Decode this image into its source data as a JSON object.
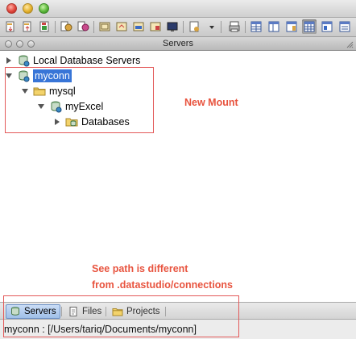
{
  "panel": {
    "title": "Servers"
  },
  "tree": {
    "items": [
      {
        "label": "Local Database Servers"
      },
      {
        "label": "myconn"
      },
      {
        "label": "mysql"
      },
      {
        "label": "myExcel"
      },
      {
        "label": "Databases"
      }
    ]
  },
  "annotations": {
    "new_mount": "New Mount",
    "path_note_line1": "See path is different",
    "path_note_line2": "from .datastudio/connections"
  },
  "tabs": [
    {
      "label": "Servers",
      "active": true
    },
    {
      "label": "Files",
      "active": false
    },
    {
      "label": "Projects",
      "active": false
    }
  ],
  "status": {
    "text": "myconn : [/Users/tariq/Documents/myconn]"
  },
  "colors": {
    "annotation": "#e8543f",
    "selection": "#3875d7",
    "box": "#e35a5a"
  },
  "icons": [
    "server-icon",
    "connection-icon",
    "folder-icon",
    "database-icon",
    "databases-folder-icon"
  ]
}
